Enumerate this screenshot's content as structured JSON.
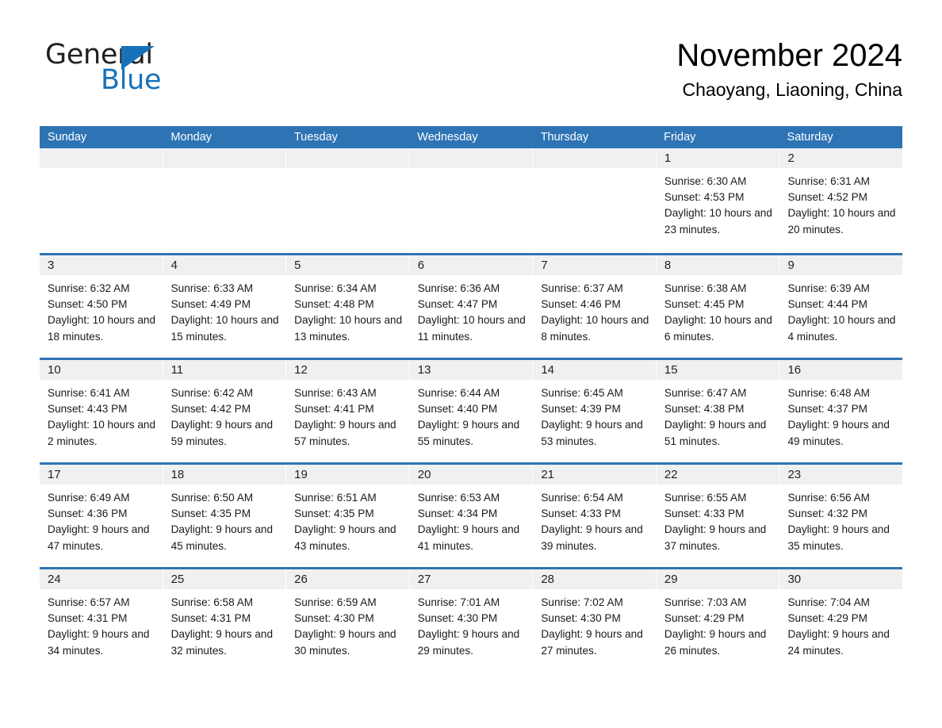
{
  "brand": {
    "word_one": "General",
    "word_two": "Blue",
    "triangle_icon": "triangle-icon",
    "accent_color": "#1872b8"
  },
  "header": {
    "title": "November 2024",
    "location": "Chaoyang, Liaoning, China"
  },
  "theme": {
    "header_blue": "#2e74b5",
    "daynum_strip": "#f0f0f0",
    "text": "#000000"
  },
  "weekdays": [
    "Sunday",
    "Monday",
    "Tuesday",
    "Wednesday",
    "Thursday",
    "Friday",
    "Saturday"
  ],
  "weeks": [
    [
      {
        "day": "",
        "sunrise": "",
        "sunset": "",
        "daylight": ""
      },
      {
        "day": "",
        "sunrise": "",
        "sunset": "",
        "daylight": ""
      },
      {
        "day": "",
        "sunrise": "",
        "sunset": "",
        "daylight": ""
      },
      {
        "day": "",
        "sunrise": "",
        "sunset": "",
        "daylight": ""
      },
      {
        "day": "",
        "sunrise": "",
        "sunset": "",
        "daylight": ""
      },
      {
        "day": "1",
        "sunrise": "Sunrise: 6:30 AM",
        "sunset": "Sunset: 4:53 PM",
        "daylight": "Daylight: 10 hours and 23 minutes."
      },
      {
        "day": "2",
        "sunrise": "Sunrise: 6:31 AM",
        "sunset": "Sunset: 4:52 PM",
        "daylight": "Daylight: 10 hours and 20 minutes."
      }
    ],
    [
      {
        "day": "3",
        "sunrise": "Sunrise: 6:32 AM",
        "sunset": "Sunset: 4:50 PM",
        "daylight": "Daylight: 10 hours and 18 minutes."
      },
      {
        "day": "4",
        "sunrise": "Sunrise: 6:33 AM",
        "sunset": "Sunset: 4:49 PM",
        "daylight": "Daylight: 10 hours and 15 minutes."
      },
      {
        "day": "5",
        "sunrise": "Sunrise: 6:34 AM",
        "sunset": "Sunset: 4:48 PM",
        "daylight": "Daylight: 10 hours and 13 minutes."
      },
      {
        "day": "6",
        "sunrise": "Sunrise: 6:36 AM",
        "sunset": "Sunset: 4:47 PM",
        "daylight": "Daylight: 10 hours and 11 minutes."
      },
      {
        "day": "7",
        "sunrise": "Sunrise: 6:37 AM",
        "sunset": "Sunset: 4:46 PM",
        "daylight": "Daylight: 10 hours and 8 minutes."
      },
      {
        "day": "8",
        "sunrise": "Sunrise: 6:38 AM",
        "sunset": "Sunset: 4:45 PM",
        "daylight": "Daylight: 10 hours and 6 minutes."
      },
      {
        "day": "9",
        "sunrise": "Sunrise: 6:39 AM",
        "sunset": "Sunset: 4:44 PM",
        "daylight": "Daylight: 10 hours and 4 minutes."
      }
    ],
    [
      {
        "day": "10",
        "sunrise": "Sunrise: 6:41 AM",
        "sunset": "Sunset: 4:43 PM",
        "daylight": "Daylight: 10 hours and 2 minutes."
      },
      {
        "day": "11",
        "sunrise": "Sunrise: 6:42 AM",
        "sunset": "Sunset: 4:42 PM",
        "daylight": "Daylight: 9 hours and 59 minutes."
      },
      {
        "day": "12",
        "sunrise": "Sunrise: 6:43 AM",
        "sunset": "Sunset: 4:41 PM",
        "daylight": "Daylight: 9 hours and 57 minutes."
      },
      {
        "day": "13",
        "sunrise": "Sunrise: 6:44 AM",
        "sunset": "Sunset: 4:40 PM",
        "daylight": "Daylight: 9 hours and 55 minutes."
      },
      {
        "day": "14",
        "sunrise": "Sunrise: 6:45 AM",
        "sunset": "Sunset: 4:39 PM",
        "daylight": "Daylight: 9 hours and 53 minutes."
      },
      {
        "day": "15",
        "sunrise": "Sunrise: 6:47 AM",
        "sunset": "Sunset: 4:38 PM",
        "daylight": "Daylight: 9 hours and 51 minutes."
      },
      {
        "day": "16",
        "sunrise": "Sunrise: 6:48 AM",
        "sunset": "Sunset: 4:37 PM",
        "daylight": "Daylight: 9 hours and 49 minutes."
      }
    ],
    [
      {
        "day": "17",
        "sunrise": "Sunrise: 6:49 AM",
        "sunset": "Sunset: 4:36 PM",
        "daylight": "Daylight: 9 hours and 47 minutes."
      },
      {
        "day": "18",
        "sunrise": "Sunrise: 6:50 AM",
        "sunset": "Sunset: 4:35 PM",
        "daylight": "Daylight: 9 hours and 45 minutes."
      },
      {
        "day": "19",
        "sunrise": "Sunrise: 6:51 AM",
        "sunset": "Sunset: 4:35 PM",
        "daylight": "Daylight: 9 hours and 43 minutes."
      },
      {
        "day": "20",
        "sunrise": "Sunrise: 6:53 AM",
        "sunset": "Sunset: 4:34 PM",
        "daylight": "Daylight: 9 hours and 41 minutes."
      },
      {
        "day": "21",
        "sunrise": "Sunrise: 6:54 AM",
        "sunset": "Sunset: 4:33 PM",
        "daylight": "Daylight: 9 hours and 39 minutes."
      },
      {
        "day": "22",
        "sunrise": "Sunrise: 6:55 AM",
        "sunset": "Sunset: 4:33 PM",
        "daylight": "Daylight: 9 hours and 37 minutes."
      },
      {
        "day": "23",
        "sunrise": "Sunrise: 6:56 AM",
        "sunset": "Sunset: 4:32 PM",
        "daylight": "Daylight: 9 hours and 35 minutes."
      }
    ],
    [
      {
        "day": "24",
        "sunrise": "Sunrise: 6:57 AM",
        "sunset": "Sunset: 4:31 PM",
        "daylight": "Daylight: 9 hours and 34 minutes."
      },
      {
        "day": "25",
        "sunrise": "Sunrise: 6:58 AM",
        "sunset": "Sunset: 4:31 PM",
        "daylight": "Daylight: 9 hours and 32 minutes."
      },
      {
        "day": "26",
        "sunrise": "Sunrise: 6:59 AM",
        "sunset": "Sunset: 4:30 PM",
        "daylight": "Daylight: 9 hours and 30 minutes."
      },
      {
        "day": "27",
        "sunrise": "Sunrise: 7:01 AM",
        "sunset": "Sunset: 4:30 PM",
        "daylight": "Daylight: 9 hours and 29 minutes."
      },
      {
        "day": "28",
        "sunrise": "Sunrise: 7:02 AM",
        "sunset": "Sunset: 4:30 PM",
        "daylight": "Daylight: 9 hours and 27 minutes."
      },
      {
        "day": "29",
        "sunrise": "Sunrise: 7:03 AM",
        "sunset": "Sunset: 4:29 PM",
        "daylight": "Daylight: 9 hours and 26 minutes."
      },
      {
        "day": "30",
        "sunrise": "Sunrise: 7:04 AM",
        "sunset": "Sunset: 4:29 PM",
        "daylight": "Daylight: 9 hours and 24 minutes."
      }
    ]
  ]
}
